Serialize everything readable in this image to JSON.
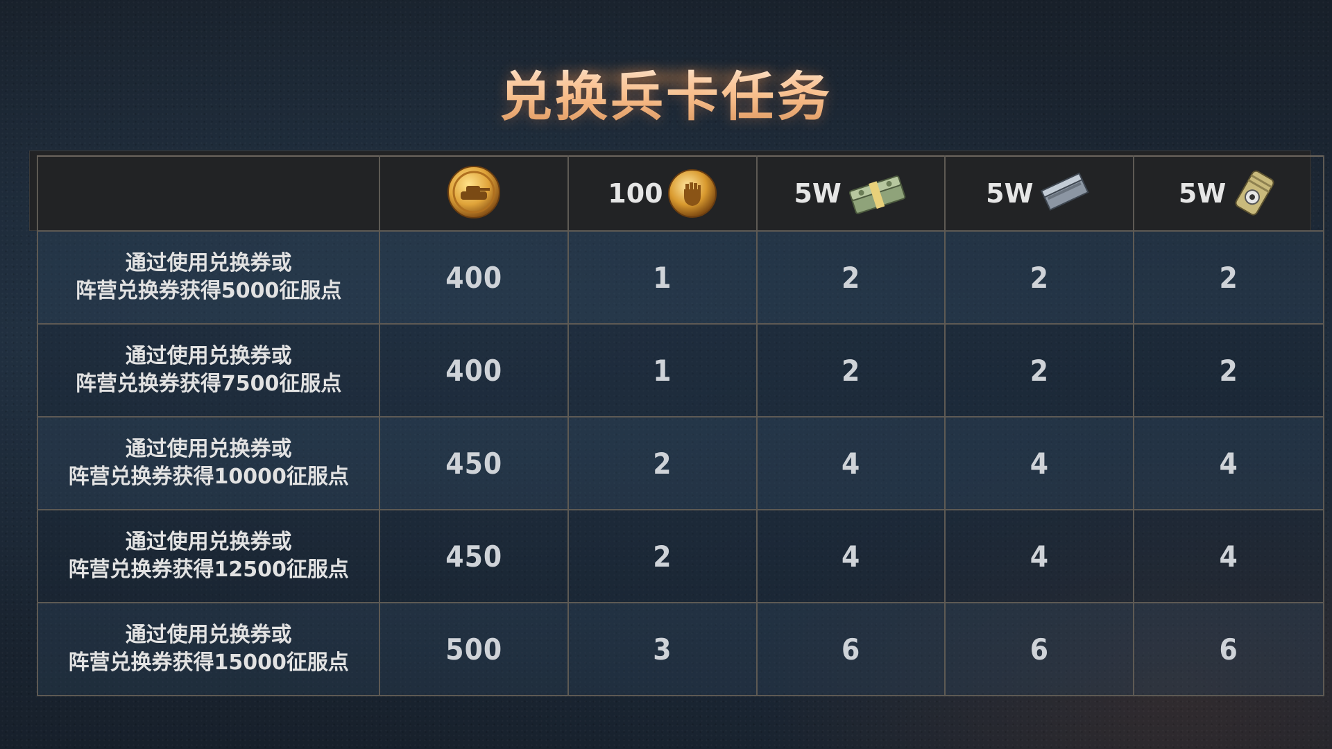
{
  "title": "兑换兵卡任务",
  "header": {
    "col_tank": {
      "amount": "",
      "icon": "tank-coin-icon"
    },
    "col_fist": {
      "amount": "100",
      "icon": "fist-medal-icon"
    },
    "col_cash": {
      "amount": "5W",
      "icon": "cash-stack-icon"
    },
    "col_metal": {
      "amount": "5W",
      "icon": "metal-ingot-icon"
    },
    "col_fuel": {
      "amount": "5W",
      "icon": "fuel-can-icon"
    }
  },
  "rows": [
    {
      "line1": "通过使用兑换券或",
      "line2": "阵营兑换券获得5000征服点",
      "v1": "400",
      "v2": "1",
      "v3": "2",
      "v4": "2",
      "v5": "2"
    },
    {
      "line1": "通过使用兑换券或",
      "line2": "阵营兑换券获得7500征服点",
      "v1": "400",
      "v2": "1",
      "v3": "2",
      "v4": "2",
      "v5": "2"
    },
    {
      "line1": "通过使用兑换券或",
      "line2": "阵营兑换券获得10000征服点",
      "v1": "450",
      "v2": "2",
      "v3": "4",
      "v4": "4",
      "v5": "4"
    },
    {
      "line1": "通过使用兑换券或",
      "line2": "阵营兑换券获得12500征服点",
      "v1": "450",
      "v2": "2",
      "v3": "4",
      "v4": "4",
      "v5": "4"
    },
    {
      "line1": "通过使用兑换券或",
      "line2": "阵营兑换券获得15000征服点",
      "v1": "500",
      "v2": "3",
      "v3": "6",
      "v4": "6",
      "v5": "6"
    }
  ],
  "colors": {
    "title_top": "#fff4e8",
    "title_bottom": "#d7925a",
    "grid_line": "#5e5a54",
    "header_bg": "#222325",
    "coin_gold": "#e0a43a"
  }
}
